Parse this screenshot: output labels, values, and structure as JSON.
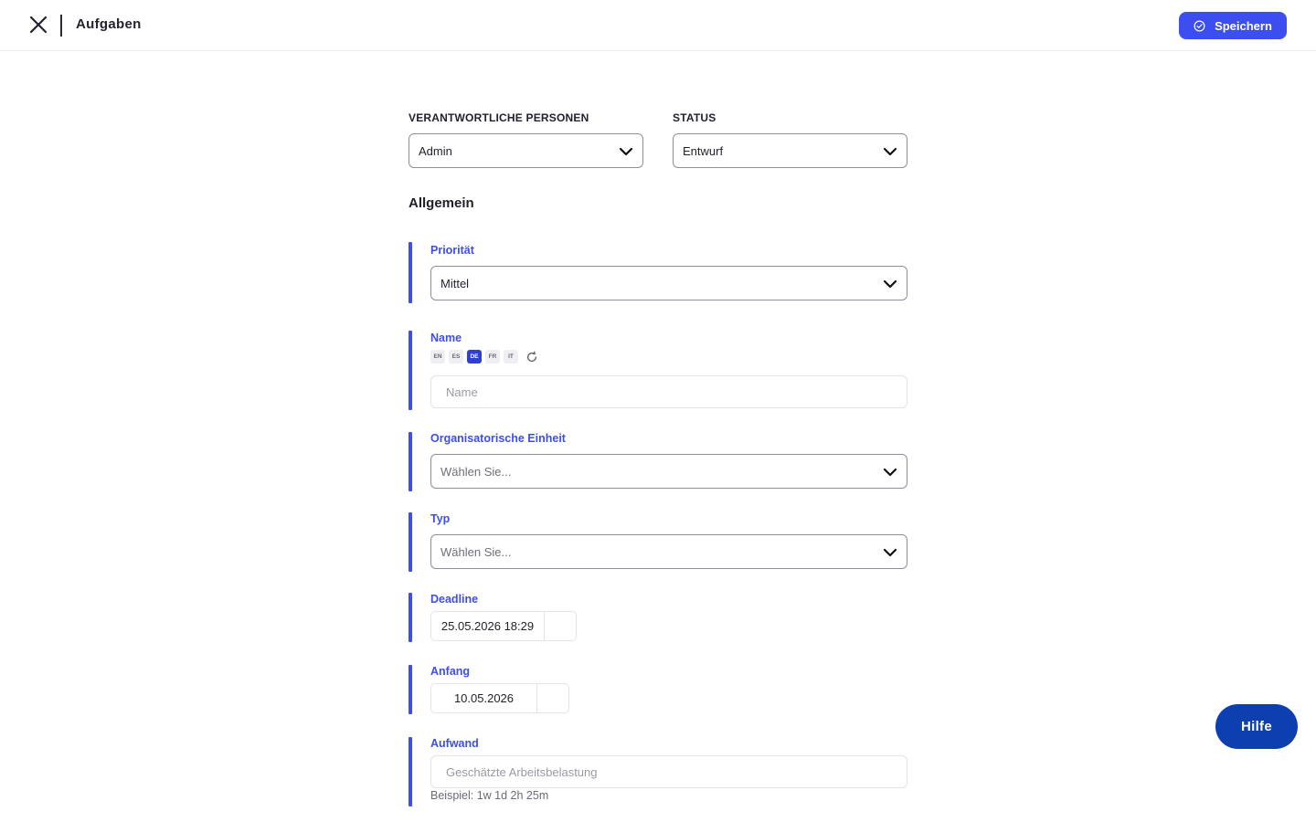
{
  "header": {
    "title": "Aufgaben",
    "save_label": "Speichern"
  },
  "responsible": {
    "label": "VERANTWORTLICHE PERSONEN",
    "value": "Admin"
  },
  "status": {
    "label": "STATUS",
    "value": "Entwurf"
  },
  "section": {
    "title": "Allgemein"
  },
  "fields": {
    "priority": {
      "label": "Priorität",
      "value": "Mittel"
    },
    "name": {
      "label": "Name",
      "placeholder": "Name",
      "languages": [
        "EN",
        "ES",
        "DE",
        "FR",
        "IT"
      ],
      "active_language": "DE"
    },
    "org_unit": {
      "label": "Organisatorische Einheit",
      "placeholder": "Wählen Sie..."
    },
    "type": {
      "label": "Typ",
      "placeholder": "Wählen Sie..."
    },
    "deadline": {
      "label": "Deadline",
      "value": "25.05.2026 18:29"
    },
    "start": {
      "label": "Anfang",
      "value": "10.05.2026"
    },
    "effort": {
      "label": "Aufwand",
      "placeholder": "Geschätzte Arbeitsbelastung",
      "hint": "Beispiel: 1w 1d 2h 25m"
    }
  },
  "help": {
    "label": "Hilfe"
  },
  "icons": [
    "close-icon",
    "check-circle-icon",
    "chevron-down-icon",
    "refresh-icon"
  ],
  "colors": {
    "accent": "#3d4ef0",
    "help_button": "#0e3fb0"
  }
}
